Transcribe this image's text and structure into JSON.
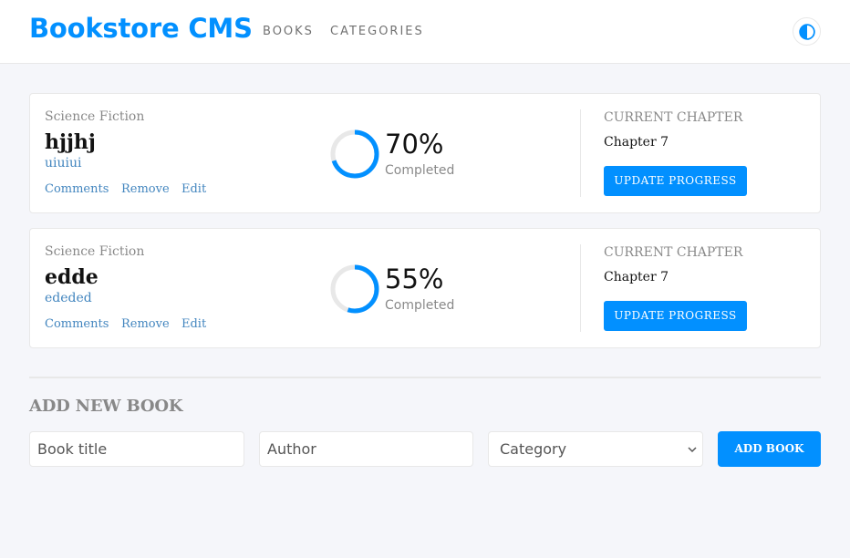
{
  "header": {
    "brand": "Bookstore CMS",
    "nav": [
      "BOOKS",
      "CATEGORIES"
    ],
    "user_icon": "user-icon",
    "accent_color": "#0290ff"
  },
  "books": [
    {
      "category": "Science Fiction",
      "title": "hjjhj",
      "author": "uiuiui",
      "actions": [
        "Comments",
        "Remove",
        "Edit"
      ],
      "progress_percent": 70,
      "progress_label": "70%",
      "completed_label": "Completed",
      "current_chapter_label": "CURRENT CHAPTER",
      "current_chapter": "Chapter 7",
      "update_label": "UPDATE PROGRESS"
    },
    {
      "category": "Science Fiction",
      "title": "edde",
      "author": "ededed",
      "actions": [
        "Comments",
        "Remove",
        "Edit"
      ],
      "progress_percent": 55,
      "progress_label": "55%",
      "completed_label": "Completed",
      "current_chapter_label": "CURRENT CHAPTER",
      "current_chapter": "Chapter 7",
      "update_label": "UPDATE PROGRESS"
    }
  ],
  "form": {
    "title": "ADD NEW BOOK",
    "title_placeholder": "Book title",
    "author_placeholder": "Author",
    "category_selected": "Category",
    "submit_label": "ADD BOOK"
  }
}
